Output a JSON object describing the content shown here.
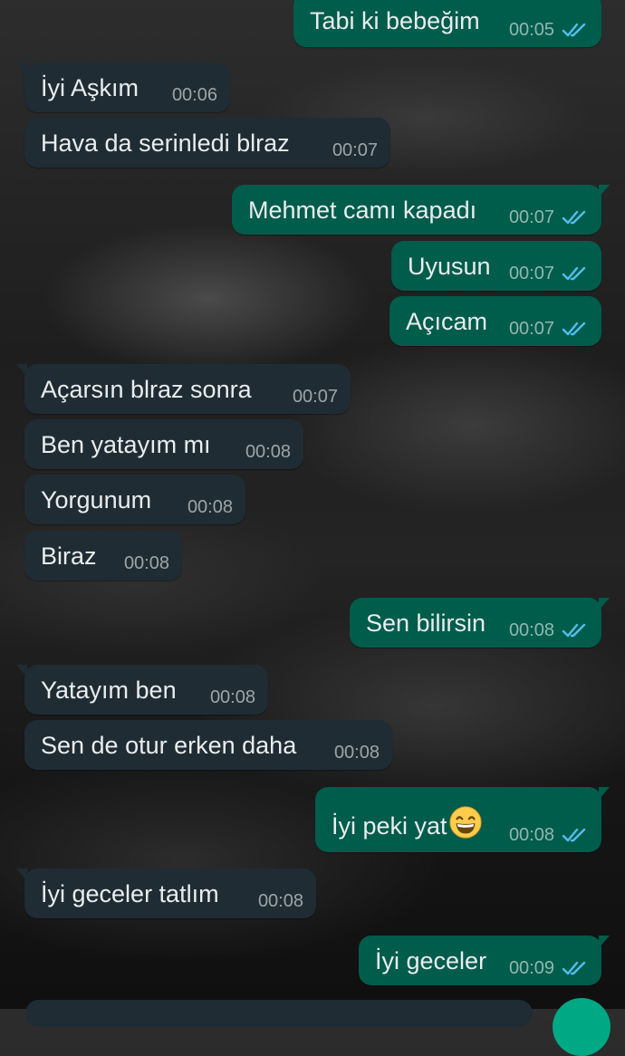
{
  "messages": [
    {
      "dir": "out",
      "text": "Tabi ki bebeğim",
      "time": "00:05",
      "read": true
    },
    {
      "dir": "in",
      "text": "İyi Aşkım",
      "time": "00:06"
    },
    {
      "dir": "in",
      "text": "Hava da serinledi blraz",
      "time": "00:07"
    },
    {
      "dir": "out",
      "text": "Mehmet camı kapadı",
      "time": "00:07",
      "read": true
    },
    {
      "dir": "out",
      "text": "Uyusun",
      "time": "00:07",
      "read": true
    },
    {
      "dir": "out",
      "text": "Açıcam",
      "time": "00:07",
      "read": true
    },
    {
      "dir": "in",
      "text": "Açarsın blraz sonra",
      "time": "00:07"
    },
    {
      "dir": "in",
      "text": "Ben yatayım mı",
      "time": "00:08"
    },
    {
      "dir": "in",
      "text": "Yorgunum",
      "time": "00:08"
    },
    {
      "dir": "in",
      "text": "Biraz",
      "time": "00:08"
    },
    {
      "dir": "out",
      "text": "Sen bilirsin",
      "time": "00:08",
      "read": true
    },
    {
      "dir": "in",
      "text": "Yatayım ben",
      "time": "00:08"
    },
    {
      "dir": "in",
      "text": "Sen de otur erken daha",
      "time": "00:08"
    },
    {
      "dir": "out",
      "text": "İyi peki yat",
      "emoji": "grinning-smiling-eyes-emoji",
      "time": "00:08",
      "read": true
    },
    {
      "dir": "in",
      "text": "İyi geceler tatlım",
      "time": "00:08"
    },
    {
      "dir": "out",
      "text": "İyi geceler",
      "time": "00:09",
      "read": true
    }
  ],
  "colors": {
    "incoming_bubble": "#202c33",
    "outgoing_bubble": "#005c4b",
    "read_ticks": "#53bdeb",
    "fab": "#00a884"
  },
  "icons": {
    "read_receipt": "double-check-icon"
  }
}
